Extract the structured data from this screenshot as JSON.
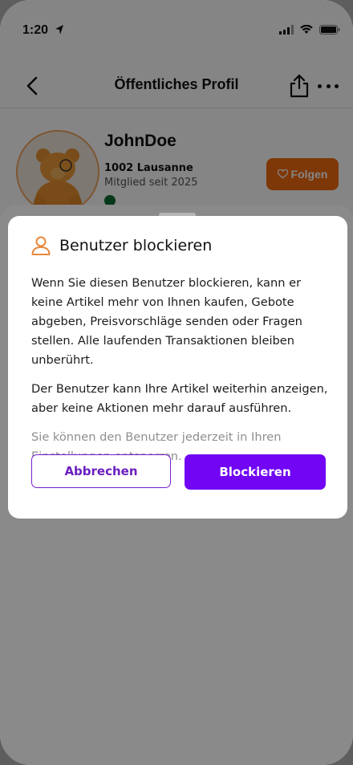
{
  "status_bar": {
    "time": "1:20"
  },
  "nav": {
    "title": "Öffentliches Profil"
  },
  "profile": {
    "username": "JohnDoe",
    "location": "1002 Lausanne",
    "member_since": "Mitglied seit 2025",
    "follow_label": "Folgen"
  },
  "dialog": {
    "title": "Benutzer blockieren",
    "paragraphs": [
      "Wenn Sie diesen Benutzer blockieren, kann er keine Artikel mehr von Ihnen kaufen, Gebote abgeben, Preisvorschläge senden oder Fragen stellen. Alle laufenden Transaktionen bleiben unberührt.",
      "Der Benutzer kann Ihre Artikel weiterhin anzeigen, aber keine Aktionen mehr darauf ausführen.",
      "Sie können den Benutzer jederzeit in Ihren Einstellungen entsperren."
    ],
    "cancel_label": "Abbrechen",
    "confirm_label": "Blockieren"
  },
  "colors": {
    "accent": "#7105f4",
    "follow": "#f26a0f",
    "user_icon": "#e8873a"
  },
  "icons": {
    "back": "chevron-left-icon",
    "share": "share-icon",
    "more": "more-icon",
    "user": "user-icon",
    "heart": "heart-icon"
  }
}
